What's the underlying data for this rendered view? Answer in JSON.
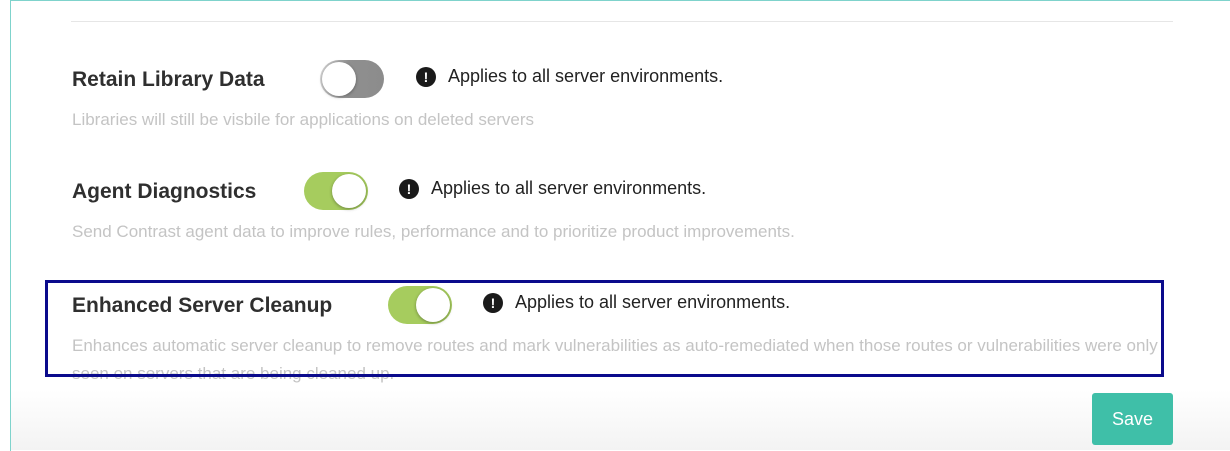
{
  "settings": [
    {
      "title": "Retain Library Data",
      "enabled": false,
      "info": "Applies to all server environments.",
      "description": "Libraries will still be visbile for applications on deleted servers"
    },
    {
      "title": "Agent Diagnostics",
      "enabled": true,
      "info": "Applies to all server environments.",
      "description": "Send Contrast agent data to improve rules, performance and to prioritize product improvements."
    },
    {
      "title": "Enhanced Server Cleanup",
      "enabled": true,
      "info": "Applies to all server environments.",
      "description": "Enhances automatic server cleanup to remove routes and mark vulnerabilities as auto-remediated when those routes or vulnerabilities were only seen on servers that are being cleaned up."
    }
  ],
  "info_icon": {
    "glyph": "!",
    "name": "exclamation-circle-icon"
  },
  "save_label": "Save",
  "colors": {
    "toggle_on": "#a6cc5e",
    "toggle_off": "#8c8c8c",
    "save_button": "#3fbfa8",
    "highlight_border": "#0b0b8c",
    "panel_border": "#7fd3cc"
  }
}
